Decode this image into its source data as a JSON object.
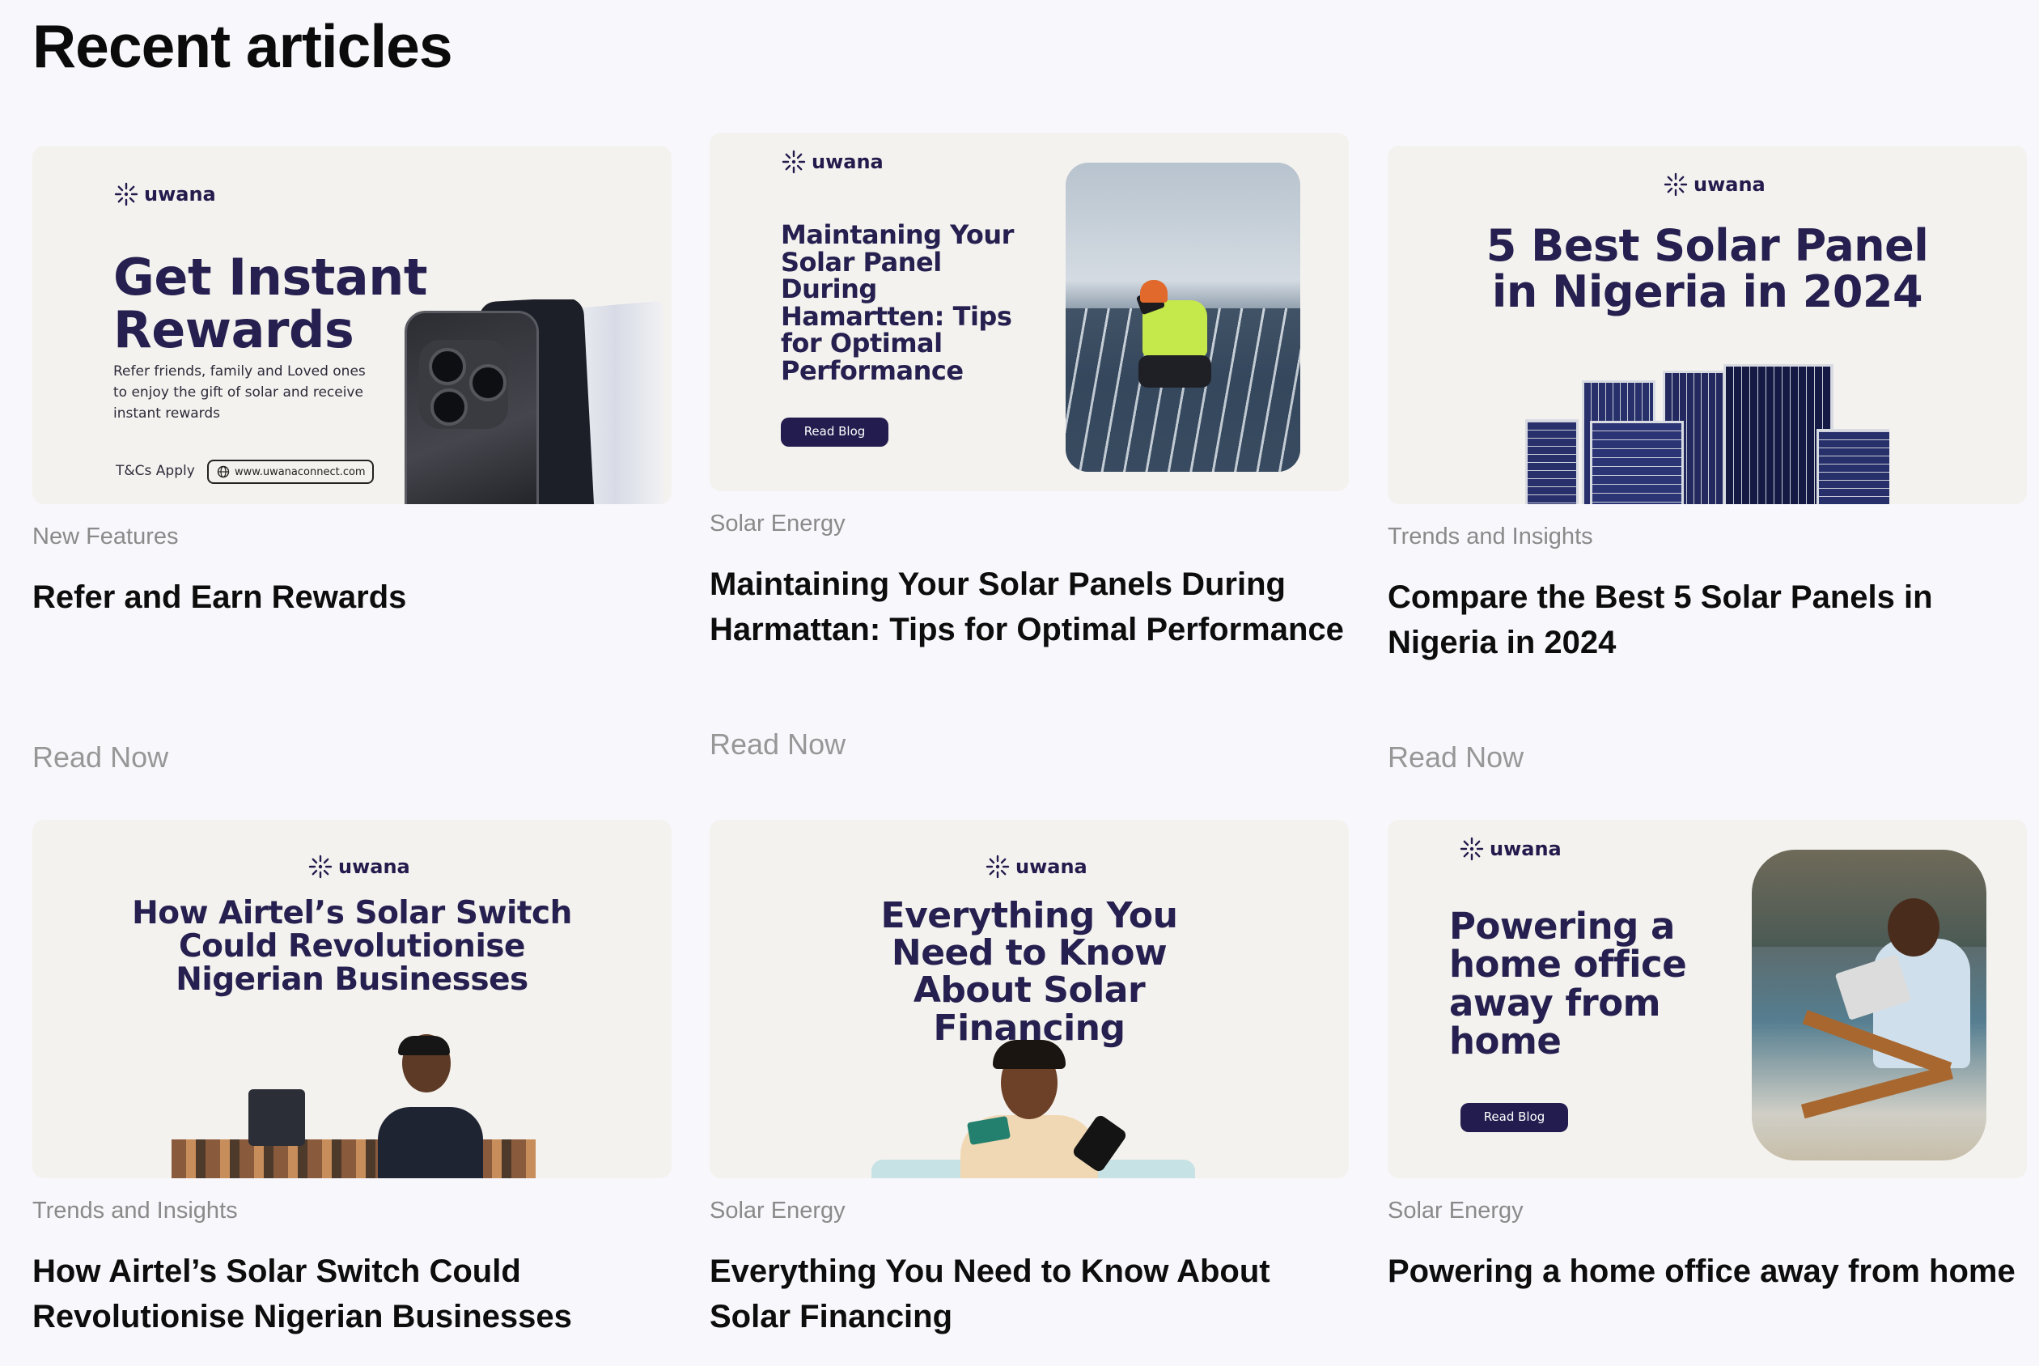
{
  "page": {
    "title": "Recent articles"
  },
  "brand_name": "uwana",
  "read_now_label": "Read Now",
  "articles": [
    {
      "category": "New Features",
      "title": "Refer and Earn Rewards",
      "banner": {
        "headline": "Get Instant Rewards",
        "body": "Refer friends, family and Loved ones to enjoy the gift of solar and receive instant rewards",
        "tcs": "T&Cs Apply",
        "url": "www.uwanaconnect.com"
      }
    },
    {
      "category": "Solar Energy",
      "title": "Maintaining Your Solar Panels During Harmattan: Tips for Optimal Performance",
      "banner": {
        "headline": "Maintaning Your Solar Panel During Hamartten: Tips for Optimal Performance",
        "button": "Read Blog"
      }
    },
    {
      "category": "Trends and Insights",
      "title": "Compare the Best 5 Solar Panels in Nigeria in 2024",
      "banner": {
        "headline": "5 Best Solar Panel in Nigeria in 2024"
      }
    },
    {
      "category": "Trends and Insights",
      "title": "How Airtel’s Solar Switch Could Revolutionise Nigerian Businesses",
      "banner": {
        "headline": "How Airtel’s Solar Switch Could Revolutionise Nigerian Businesses"
      }
    },
    {
      "category": "Solar Energy",
      "title": "Everything You Need to Know About Solar Financing",
      "banner": {
        "headline": "Everything You Need to Know About Solar Financing"
      }
    },
    {
      "category": "Solar Energy",
      "title": "Powering a home office away from home",
      "banner": {
        "headline": "Powering a home office away from home",
        "button": "Read Blog"
      }
    }
  ],
  "colors": {
    "brand_navy": "#231c4f",
    "page_bg": "#f8f7fc",
    "muted": "#8a8a8a"
  }
}
